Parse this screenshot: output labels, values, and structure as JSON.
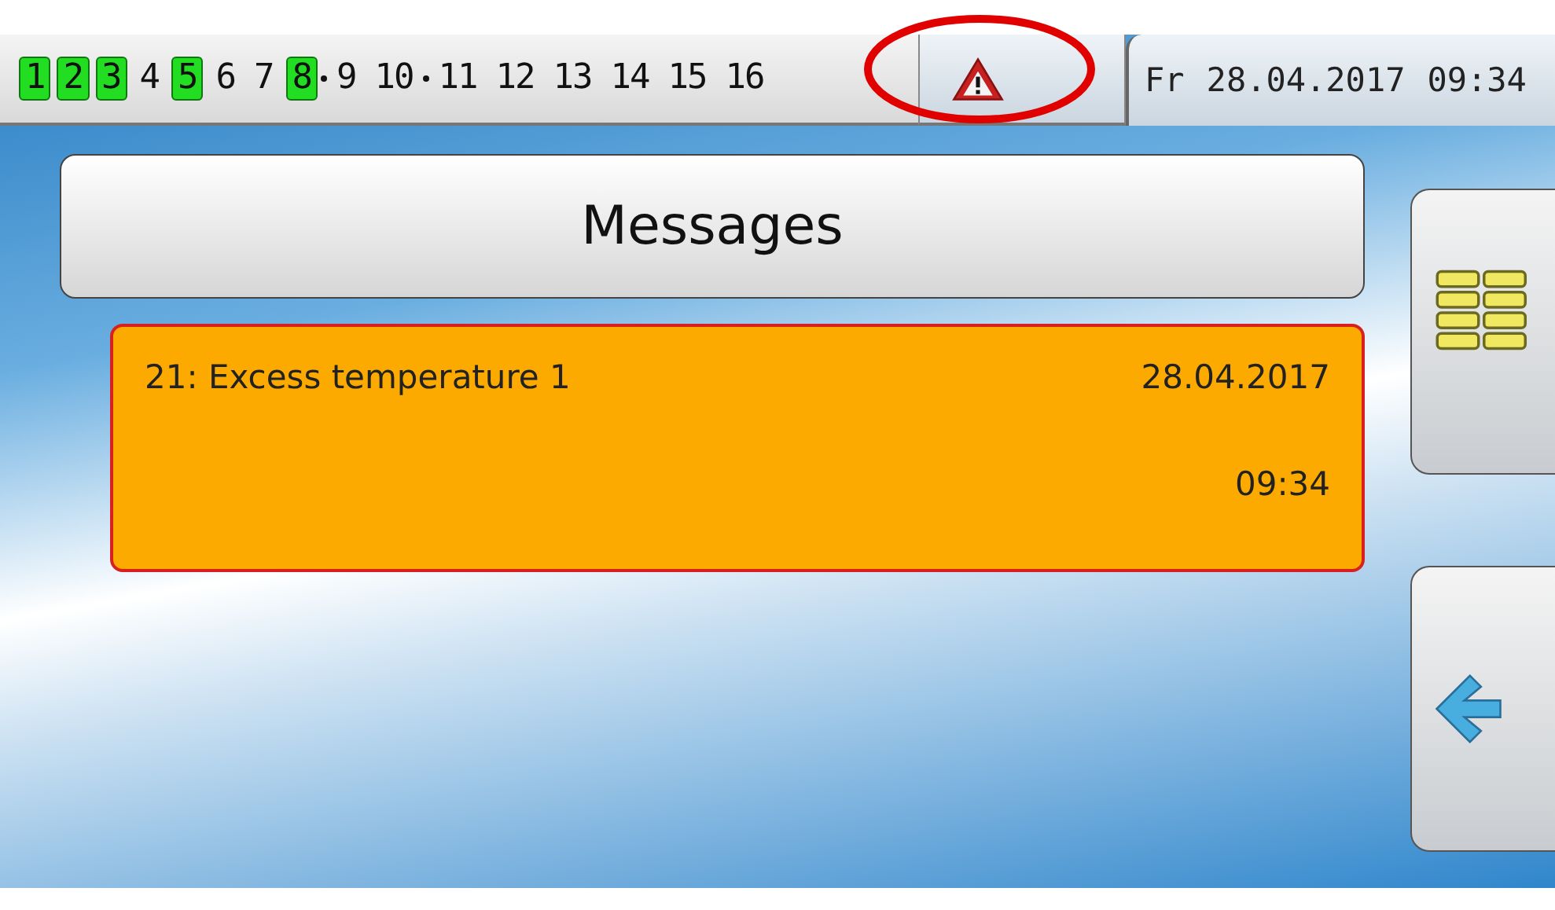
{
  "outputs": [
    {
      "label": "1",
      "on": true,
      "linked": false
    },
    {
      "label": "2",
      "on": true,
      "linked": false
    },
    {
      "label": "3",
      "on": true,
      "linked": false
    },
    {
      "label": "4",
      "on": false,
      "linked": false
    },
    {
      "label": "5",
      "on": true,
      "linked": false
    },
    {
      "label": "6",
      "on": false,
      "linked": false
    },
    {
      "label": "7",
      "on": false,
      "linked": false
    },
    {
      "label": "8",
      "on": true,
      "linked": true
    },
    {
      "label": "9",
      "on": false,
      "linked": false
    },
    {
      "label": "10",
      "on": false,
      "linked": true
    },
    {
      "label": "11",
      "on": false,
      "linked": false
    },
    {
      "label": "12",
      "on": false,
      "linked": false
    },
    {
      "label": "13",
      "on": false,
      "linked": false
    },
    {
      "label": "14",
      "on": false,
      "linked": false
    },
    {
      "label": "15",
      "on": false,
      "linked": false
    },
    {
      "label": "16",
      "on": false,
      "linked": false
    }
  ],
  "datetime": {
    "day": "Fr",
    "date": "28.04.2017",
    "time": "09:34"
  },
  "title": "Messages",
  "messages": [
    {
      "text": "21: Excess temperature 1",
      "date": "28.04.2017",
      "time": "09:34"
    }
  ]
}
